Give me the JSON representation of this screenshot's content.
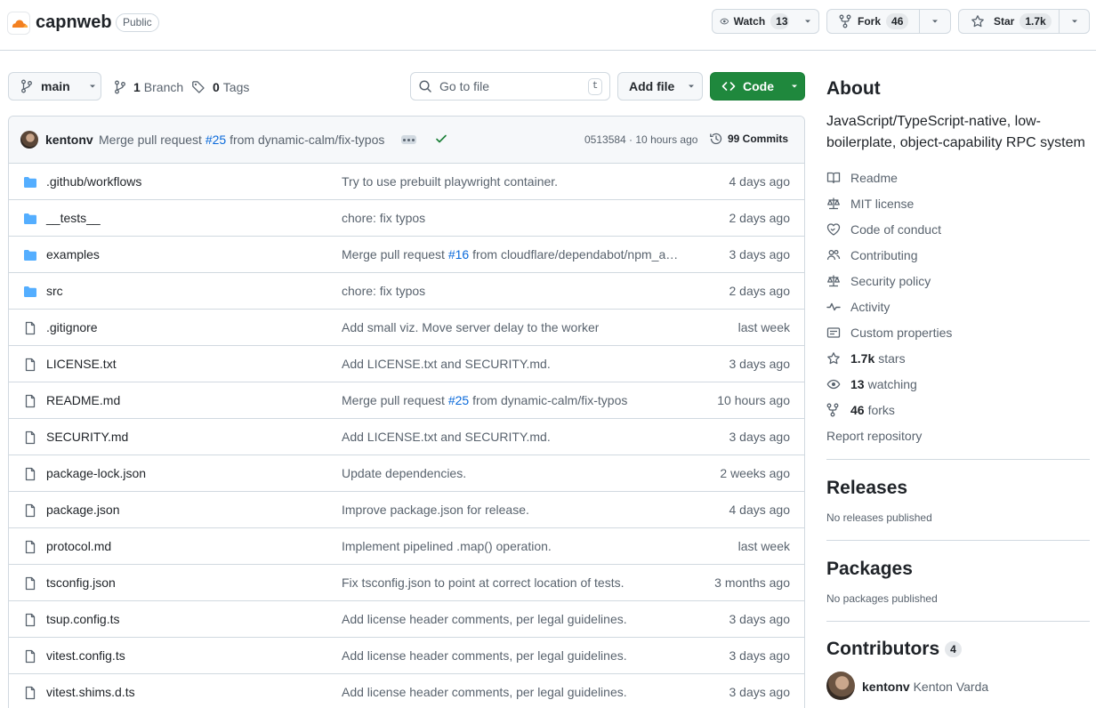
{
  "repo": {
    "name": "capnweb",
    "visibility": "Public",
    "watch": {
      "label": "Watch",
      "count": "13"
    },
    "fork": {
      "label": "Fork",
      "count": "46"
    },
    "star": {
      "label": "Star",
      "count": "1.7k"
    }
  },
  "toolbar": {
    "branch": "main",
    "branches_count": "1",
    "branches_label": "Branch",
    "tags_count": "0",
    "tags_label": "Tags",
    "search_placeholder": "Go to file",
    "search_key": "t",
    "add_file": "Add file",
    "code": "Code"
  },
  "last_commit": {
    "author": "kentonv",
    "msg_prefix": "Merge pull request",
    "pr": "#25",
    "msg_suffix": "from dynamic-calm/fix-typos",
    "meta": "0513584 · 10 hours ago",
    "commits": "99 Commits"
  },
  "files": [
    {
      "type": "dir",
      "name": ".github/workflows",
      "msg": "Try to use prebuilt playwright container.",
      "date": "4 days ago"
    },
    {
      "type": "dir",
      "name": "__tests__",
      "msg": "chore: fix typos",
      "date": "2 days ago"
    },
    {
      "type": "dir",
      "name": "examples",
      "msg_prefix": "Merge pull request",
      "pr": "#16",
      "msg_suffix": "from cloudflare/dependabot/npm_a…",
      "date": "3 days ago"
    },
    {
      "type": "dir",
      "name": "src",
      "msg": "chore: fix typos",
      "date": "2 days ago"
    },
    {
      "type": "file",
      "name": ".gitignore",
      "msg": "Add small viz. Move server delay to the worker",
      "date": "last week"
    },
    {
      "type": "file",
      "name": "LICENSE.txt",
      "msg": "Add LICENSE.txt and SECURITY.md.",
      "date": "3 days ago"
    },
    {
      "type": "file",
      "name": "README.md",
      "msg_prefix": "Merge pull request",
      "pr": "#25",
      "msg_suffix": "from dynamic-calm/fix-typos",
      "date": "10 hours ago"
    },
    {
      "type": "file",
      "name": "SECURITY.md",
      "msg": "Add LICENSE.txt and SECURITY.md.",
      "date": "3 days ago"
    },
    {
      "type": "file",
      "name": "package-lock.json",
      "msg": "Update dependencies.",
      "date": "2 weeks ago"
    },
    {
      "type": "file",
      "name": "package.json",
      "msg": "Improve package.json for release.",
      "date": "4 days ago"
    },
    {
      "type": "file",
      "name": "protocol.md",
      "msg": "Implement pipelined .map() operation.",
      "date": "last week"
    },
    {
      "type": "file",
      "name": "tsconfig.json",
      "msg": "Fix tsconfig.json to point at correct location of tests.",
      "date": "3 months ago"
    },
    {
      "type": "file",
      "name": "tsup.config.ts",
      "msg": "Add license header comments, per legal guidelines.",
      "date": "3 days ago"
    },
    {
      "type": "file",
      "name": "vitest.config.ts",
      "msg": "Add license header comments, per legal guidelines.",
      "date": "3 days ago"
    },
    {
      "type": "file",
      "name": "vitest.shims.d.ts",
      "msg": "Add license header comments, per legal guidelines.",
      "date": "3 days ago"
    }
  ],
  "about": {
    "title": "About",
    "description": "JavaScript/TypeScript-native, low-boilerplate, object-capability RPC system",
    "links": [
      {
        "icon": "book-icon",
        "label": "Readme"
      },
      {
        "icon": "law-icon",
        "label": "MIT license"
      },
      {
        "icon": "heart-icon",
        "label": "Code of conduct"
      },
      {
        "icon": "people-icon",
        "label": "Contributing"
      },
      {
        "icon": "law-icon",
        "label": "Security policy"
      },
      {
        "icon": "pulse-icon",
        "label": "Activity"
      },
      {
        "icon": "note-icon",
        "label": "Custom properties"
      }
    ],
    "stars": {
      "count": "1.7k",
      "label": "stars"
    },
    "watching": {
      "count": "13",
      "label": "watching"
    },
    "forks": {
      "count": "46",
      "label": "forks"
    },
    "report": "Report repository"
  },
  "releases": {
    "title": "Releases",
    "empty": "No releases published"
  },
  "packages": {
    "title": "Packages",
    "empty": "No packages published"
  },
  "contributors": {
    "title": "Contributors",
    "count": "4",
    "first": {
      "login": "kentonv",
      "name": "Kenton Varda"
    }
  },
  "colors": {
    "accent": "#0969da",
    "primary_button": "#1f883d",
    "folder": "#54aeff",
    "border": "#d1d9e0",
    "muted": "#59636e"
  }
}
